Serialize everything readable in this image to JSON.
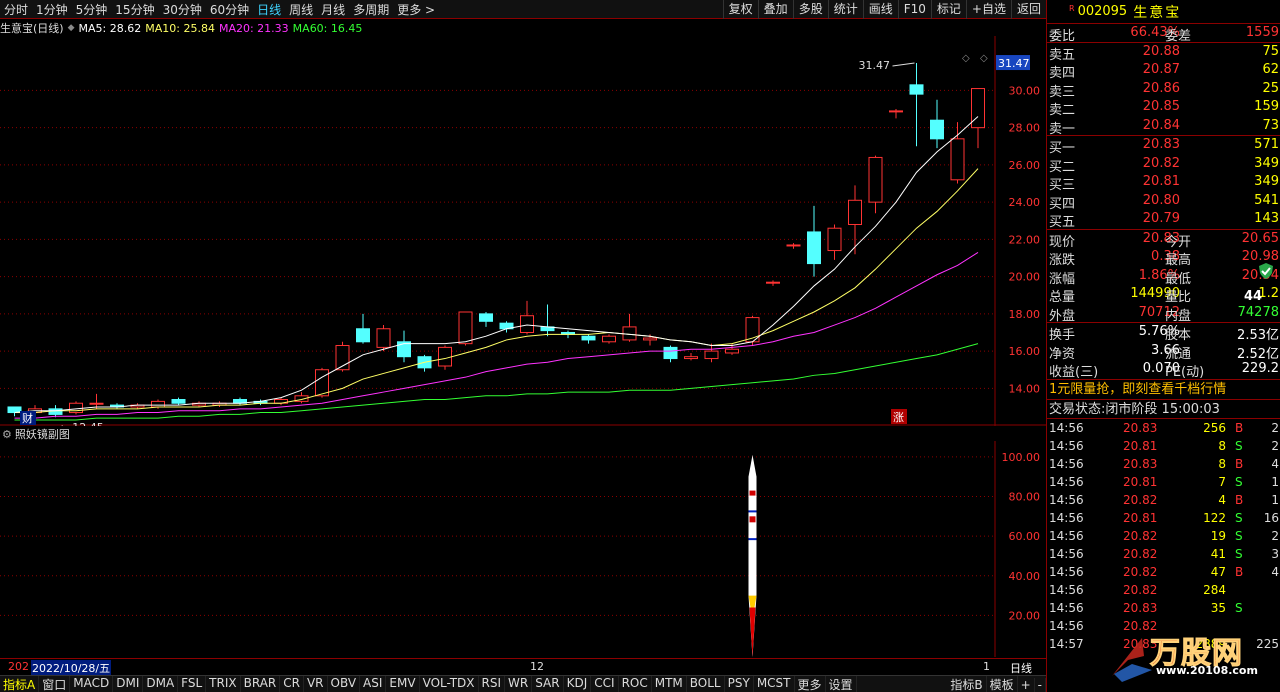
{
  "topbar": {
    "periods": [
      "分时",
      "1分钟",
      "5分钟",
      "15分钟",
      "30分钟",
      "60分钟",
      "日线",
      "周线",
      "月线",
      "多周期",
      "更多 >"
    ],
    "active_period": "日线",
    "tools": [
      "复权",
      "叠加",
      "多股",
      "统计",
      "画线",
      "F10",
      "标记",
      "+自选",
      "返回"
    ]
  },
  "ma_bar": {
    "title": "生意宝(日线)",
    "ma5": "MA5: 28.62",
    "ma10": "MA10: 25.84",
    "ma20": "MA20: 21.33",
    "ma60": "MA60: 16.45"
  },
  "main_chart": {
    "price_axis": [
      "30.00",
      "28.00",
      "26.00",
      "24.00",
      "22.00",
      "20.00",
      "18.00",
      "16.00",
      "14.00"
    ],
    "current_price_tag": "31.47",
    "high_label": "31.47",
    "low_label": "12.45",
    "cai_mark": "财",
    "zhang_mark": "涨",
    "colors": {
      "up": "#ff3333",
      "down": "#54ffff",
      "ma5": "#ffffff",
      "ma10": "#ffff66",
      "ma20": "#ff33ff",
      "ma60": "#33ff33"
    }
  },
  "chart_data": {
    "type": "candlestick",
    "ylim": [
      12.3,
      32.6
    ],
    "candles": [
      {
        "o": 13.0,
        "c": 12.7,
        "h": 13.0,
        "l": 12.5
      },
      {
        "o": 12.7,
        "c": 12.9,
        "h": 13.1,
        "l": 12.5
      },
      {
        "o": 12.9,
        "c": 12.6,
        "h": 13.1,
        "l": 12.45
      },
      {
        "o": 12.7,
        "c": 13.2,
        "h": 13.3,
        "l": 12.6
      },
      {
        "o": 13.2,
        "c": 13.2,
        "h": 13.7,
        "l": 12.9
      },
      {
        "o": 13.1,
        "c": 13.0,
        "h": 13.2,
        "l": 12.9
      },
      {
        "o": 13.0,
        "c": 13.1,
        "h": 13.2,
        "l": 12.9
      },
      {
        "o": 13.0,
        "c": 13.3,
        "h": 13.4,
        "l": 12.9
      },
      {
        "o": 13.4,
        "c": 13.2,
        "h": 13.5,
        "l": 13.1
      },
      {
        "o": 13.1,
        "c": 13.2,
        "h": 13.3,
        "l": 13.0
      },
      {
        "o": 13.1,
        "c": 13.2,
        "h": 13.3,
        "l": 13.0
      },
      {
        "o": 13.4,
        "c": 13.2,
        "h": 13.5,
        "l": 13.1
      },
      {
        "o": 13.3,
        "c": 13.2,
        "h": 13.4,
        "l": 13.1
      },
      {
        "o": 13.2,
        "c": 13.4,
        "h": 13.5,
        "l": 13.1
      },
      {
        "o": 13.3,
        "c": 13.6,
        "h": 13.8,
        "l": 13.2
      },
      {
        "o": 13.6,
        "c": 15.0,
        "h": 15.1,
        "l": 13.5
      },
      {
        "o": 15.0,
        "c": 16.3,
        "h": 16.5,
        "l": 14.9
      },
      {
        "o": 17.2,
        "c": 16.5,
        "h": 18.0,
        "l": 16.4
      },
      {
        "o": 16.2,
        "c": 17.2,
        "h": 17.4,
        "l": 16.0
      },
      {
        "o": 16.5,
        "c": 15.7,
        "h": 17.1,
        "l": 15.4
      },
      {
        "o": 15.7,
        "c": 15.1,
        "h": 15.8,
        "l": 14.9
      },
      {
        "o": 15.2,
        "c": 16.2,
        "h": 16.3,
        "l": 15.0
      },
      {
        "o": 16.4,
        "c": 18.1,
        "h": 18.1,
        "l": 16.3
      },
      {
        "o": 18.0,
        "c": 17.6,
        "h": 18.1,
        "l": 17.3
      },
      {
        "o": 17.5,
        "c": 17.2,
        "h": 17.6,
        "l": 17.0
      },
      {
        "o": 17.0,
        "c": 17.9,
        "h": 18.7,
        "l": 16.9
      },
      {
        "o": 17.3,
        "c": 17.1,
        "h": 18.5,
        "l": 16.8
      },
      {
        "o": 17.0,
        "c": 16.9,
        "h": 17.1,
        "l": 16.7
      },
      {
        "o": 16.8,
        "c": 16.6,
        "h": 16.9,
        "l": 16.4
      },
      {
        "o": 16.5,
        "c": 16.8,
        "h": 16.9,
        "l": 16.4
      },
      {
        "o": 16.6,
        "c": 17.3,
        "h": 18.0,
        "l": 16.5
      },
      {
        "o": 16.6,
        "c": 16.7,
        "h": 16.9,
        "l": 16.3
      },
      {
        "o": 16.2,
        "c": 15.6,
        "h": 16.3,
        "l": 15.4
      },
      {
        "o": 15.6,
        "c": 15.7,
        "h": 15.9,
        "l": 15.5
      },
      {
        "o": 15.6,
        "c": 16.0,
        "h": 16.4,
        "l": 15.4
      },
      {
        "o": 15.9,
        "c": 16.1,
        "h": 16.4,
        "l": 15.8
      },
      {
        "o": 16.5,
        "c": 17.8,
        "h": 17.9,
        "l": 16.3
      },
      {
        "o": 19.7,
        "c": 19.7,
        "h": 19.8,
        "l": 19.5
      },
      {
        "o": 21.7,
        "c": 21.7,
        "h": 21.8,
        "l": 21.5
      },
      {
        "o": 22.4,
        "c": 20.7,
        "h": 23.8,
        "l": 20.0
      },
      {
        "o": 21.4,
        "c": 22.6,
        "h": 22.8,
        "l": 20.9
      },
      {
        "o": 22.8,
        "c": 24.1,
        "h": 24.9,
        "l": 21.2
      },
      {
        "o": 24.0,
        "c": 26.4,
        "h": 26.5,
        "l": 23.4
      },
      {
        "o": 28.9,
        "c": 28.9,
        "h": 29.0,
        "l": 28.5
      },
      {
        "o": 30.3,
        "c": 29.8,
        "h": 31.47,
        "l": 27.0
      },
      {
        "o": 28.4,
        "c": 27.4,
        "h": 29.5,
        "l": 26.9
      },
      {
        "o": 25.2,
        "c": 27.4,
        "h": 28.3,
        "l": 25.0
      },
      {
        "o": 28.0,
        "c": 30.1,
        "h": 30.1,
        "l": 26.9
      }
    ],
    "ma5": [
      12.7,
      12.8,
      12.8,
      12.9,
      13.0,
      13.0,
      13.1,
      13.1,
      13.1,
      13.2,
      13.2,
      13.2,
      13.3,
      13.5,
      13.9,
      14.6,
      15.2,
      15.8,
      16.1,
      16.4,
      16.4,
      16.4,
      16.5,
      16.8,
      17.2,
      17.4,
      17.3,
      17.2,
      17.1,
      17.0,
      16.9,
      16.8,
      16.6,
      16.5,
      16.3,
      16.3,
      16.5,
      17.4,
      18.4,
      19.5,
      20.4,
      21.6,
      22.7,
      24.0,
      25.6,
      26.7,
      27.6,
      28.6
    ],
    "ma10": [
      12.7,
      12.7,
      12.8,
      12.8,
      12.9,
      12.9,
      12.9,
      13.0,
      13.0,
      13.0,
      13.1,
      13.1,
      13.2,
      13.2,
      13.4,
      13.7,
      14.0,
      14.5,
      14.8,
      15.1,
      15.4,
      15.6,
      15.9,
      16.2,
      16.6,
      16.8,
      16.9,
      16.9,
      16.9,
      17.0,
      16.9,
      16.8,
      16.6,
      16.5,
      16.3,
      16.4,
      16.7,
      17.1,
      17.6,
      18.1,
      18.7,
      19.4,
      20.4,
      21.5,
      22.6,
      23.5,
      24.6,
      25.8
    ],
    "ma20": [
      12.4,
      12.4,
      12.5,
      12.5,
      12.6,
      12.6,
      12.7,
      12.7,
      12.8,
      12.8,
      12.8,
      12.9,
      12.9,
      13.0,
      13.1,
      13.2,
      13.4,
      13.6,
      13.8,
      14.0,
      14.2,
      14.4,
      14.6,
      14.9,
      15.1,
      15.3,
      15.4,
      15.6,
      15.7,
      15.8,
      15.9,
      16.0,
      16.0,
      16.1,
      16.1,
      16.2,
      16.3,
      16.5,
      16.8,
      17.0,
      17.4,
      17.8,
      18.3,
      18.9,
      19.5,
      20.1,
      20.6,
      21.3
    ],
    "ma60": [
      12.3,
      12.3,
      12.3,
      12.3,
      12.4,
      12.4,
      12.4,
      12.4,
      12.5,
      12.5,
      12.6,
      12.6,
      12.7,
      12.7,
      12.8,
      12.9,
      13.0,
      13.1,
      13.2,
      13.3,
      13.4,
      13.4,
      13.5,
      13.6,
      13.6,
      13.7,
      13.7,
      13.8,
      13.8,
      13.8,
      13.9,
      13.9,
      13.9,
      14.0,
      14.1,
      14.2,
      14.3,
      14.4,
      14.5,
      14.7,
      14.8,
      15.0,
      15.2,
      15.4,
      15.6,
      15.8,
      16.1,
      16.4
    ],
    "sub_axis": [
      "100.00",
      "80.00",
      "60.00",
      "40.00",
      "20.00"
    ]
  },
  "sub_chart": {
    "title": "照妖镜副图"
  },
  "datebar": {
    "left_date": "202",
    "selected_date": "2022/10/28/五",
    "mark_12": "12",
    "mark_1": "1",
    "period": "日线"
  },
  "indicators": [
    "指标A",
    "窗口",
    "MACD",
    "DMI",
    "DMA",
    "FSL",
    "TRIX",
    "BRAR",
    "CR",
    "VR",
    "OBV",
    "ASI",
    "EMV",
    "VOL-TDX",
    "RSI",
    "WR",
    "SAR",
    "KDJ",
    "CCI",
    "ROC",
    "MTM",
    "BOLL",
    "PSY",
    "MCST",
    "更多",
    "设置"
  ],
  "indicators_right": [
    "指标B",
    "模板",
    "+",
    "-"
  ],
  "stock": {
    "r_tag": "R",
    "code": "002095",
    "name": "生意宝"
  },
  "weibi": {
    "label": "委比",
    "value": "66.43%",
    "label2": "委差",
    "value2": "1559"
  },
  "asks": [
    {
      "label": "卖五",
      "price": "20.88",
      "vol": "75"
    },
    {
      "label": "卖四",
      "price": "20.87",
      "vol": "62"
    },
    {
      "label": "卖三",
      "price": "20.86",
      "vol": "25"
    },
    {
      "label": "卖二",
      "price": "20.85",
      "vol": "159"
    },
    {
      "label": "卖一",
      "price": "20.84",
      "vol": "73"
    }
  ],
  "bids": [
    {
      "label": "买一",
      "price": "20.83",
      "vol": "571"
    },
    {
      "label": "买二",
      "price": "20.82",
      "vol": "349"
    },
    {
      "label": "买三",
      "price": "20.81",
      "vol": "349"
    },
    {
      "label": "买四",
      "price": "20.80",
      "vol": "541"
    },
    {
      "label": "买五",
      "price": "20.79",
      "vol": "143"
    }
  ],
  "quote": [
    {
      "l": "现价",
      "v": "20.83",
      "l2": "今开",
      "v2": "20.65"
    },
    {
      "l": "涨跌",
      "v": "0.38",
      "l2": "最高",
      "v2": "20.98"
    },
    {
      "l": "涨幅",
      "v": "1.86%",
      "l2": "最低",
      "v2": "20.54"
    },
    {
      "l": "总量",
      "v": "144990",
      "l2": "量比",
      "v2": "1.2"
    },
    {
      "l": "外盘",
      "v": "70712",
      "l2": "内盘",
      "v2": "74278"
    }
  ],
  "fundamentals": [
    {
      "l": "换手",
      "v": "5.76%",
      "l2": "股本",
      "v2": "2.53亿"
    },
    {
      "l": "净资",
      "v": "3.66",
      "l2": "流通",
      "v2": "2.52亿"
    },
    {
      "l": "收益(三)",
      "v": "0.070",
      "l2": "PE(动)",
      "v2": "229.2"
    }
  ],
  "promo": "1元限量抢，即刻查看千档行情",
  "trade_state": {
    "label": "交易状态:",
    "value": "闭市阶段",
    "time": "15:00:03"
  },
  "ticks": [
    {
      "t": "14:56",
      "p": "20.83",
      "v": "256",
      "bs": "B",
      "n": "2"
    },
    {
      "t": "14:56",
      "p": "20.81",
      "v": "8",
      "bs": "S",
      "n": "2"
    },
    {
      "t": "14:56",
      "p": "20.83",
      "v": "8",
      "bs": "B",
      "n": "4"
    },
    {
      "t": "14:56",
      "p": "20.81",
      "v": "7",
      "bs": "S",
      "n": "1"
    },
    {
      "t": "14:56",
      "p": "20.82",
      "v": "4",
      "bs": "B",
      "n": "1"
    },
    {
      "t": "14:56",
      "p": "20.81",
      "v": "122",
      "bs": "S",
      "n": "16"
    },
    {
      "t": "14:56",
      "p": "20.82",
      "v": "19",
      "bs": "S",
      "n": "2"
    },
    {
      "t": "14:56",
      "p": "20.82",
      "v": "41",
      "bs": "S",
      "n": "3"
    },
    {
      "t": "14:56",
      "p": "20.82",
      "v": "47",
      "bs": "B",
      "n": "4"
    },
    {
      "t": "14:56",
      "p": "20.82",
      "v": "284",
      "bs": "",
      "n": ""
    },
    {
      "t": "14:56",
      "p": "20.83",
      "v": "35",
      "bs": "S",
      "n": ""
    },
    {
      "t": "14:56",
      "p": "20.82",
      "v": "",
      "bs": "",
      "n": ""
    },
    {
      "t": "14:57",
      "p": "20.83",
      "v": "2889",
      "bs": "",
      "n": "225"
    }
  ],
  "badge_44": "44",
  "watermark": {
    "brand": "万股网",
    "url": "www.20108.com"
  }
}
